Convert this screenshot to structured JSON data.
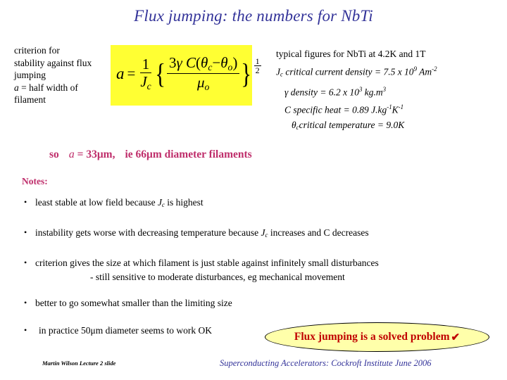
{
  "slide": {
    "title": "Flux jumping: the numbers for NbTi",
    "title_color": "#333399"
  },
  "left_block": {
    "line1": "criterion for",
    "line2": "stability against flux",
    "line3": "jumping",
    "line4_var": "a",
    "line4_rest": " = half width of",
    "line5": "filament"
  },
  "equation": {
    "box_color": "#ffff33",
    "lhs": "a",
    "equals": "=",
    "outer_num": "1",
    "outer_den_var": "J",
    "outer_den_sub": "c",
    "open_brace": "{",
    "close_brace": "}",
    "inner_num_a": "3",
    "inner_num_gamma": "γ",
    "inner_num_C": "C",
    "inner_num_open": "(",
    "inner_num_theta1": "θ",
    "inner_num_theta1_sub": "c",
    "inner_num_minus": "−",
    "inner_num_theta2": "θ",
    "inner_num_theta2_sub": "o",
    "inner_num_close": ")",
    "inner_den_mu": "μ",
    "inner_den_sub": "o",
    "exp_num": "1",
    "exp_den": "2",
    "plain_text": "a = (1/Jc){3γC(θc − θo)/μo}^(1/2)"
  },
  "right_block": {
    "heading": "typical figures for NbTi at 4.2K and 1T",
    "rows": [
      {
        "symbol": "J",
        "symbol_sub": "c",
        "label": " critical current density",
        "equals": " = ",
        "value": "7.5 x 10",
        "value_sup": "9",
        "unit": " Am",
        "unit_sup": "-2"
      },
      {
        "symbol": "γ",
        "symbol_sub": "",
        "label": " density",
        "equals": " = ",
        "value": "6.2 x 10",
        "value_sup": "3",
        "unit": " kg.m",
        "unit_sup": "3"
      },
      {
        "symbol": "C",
        "symbol_sub": "",
        "label": " specific heat",
        "equals": " = ",
        "value": "0.89",
        "value_sup": "",
        "unit": " J.kg",
        "unit_sup": "-1",
        "unit2": "K",
        "unit2_sup": "-1"
      },
      {
        "symbol": "θ",
        "symbol_sub": "c",
        "label": "critical temperature",
        "equals": "  = ",
        "value": "9.0K",
        "value_sup": "",
        "unit": "",
        "unit_sup": ""
      }
    ]
  },
  "result_line": {
    "so": "so",
    "var": "a",
    "equals": "=",
    "value": "33μm,",
    "note": "ie 66μm diameter filaments",
    "color": "#BF2E6B"
  },
  "notes": {
    "heading": "Notes:",
    "heading_color": "#BF2E6B",
    "items": [
      {
        "bullet": "•",
        "text_a": "least stable at low field because ",
        "sym": "J",
        "sym_sub": "c",
        "text_b": " is highest",
        "second_line": ""
      },
      {
        "bullet": "•",
        "text_a": "instability gets worse with decreasing temperature because ",
        "sym": "J",
        "sym_sub": "c",
        "text_b": " increases and C decreases",
        "second_line": ""
      },
      {
        "bullet": "•",
        "text_a": "criterion gives the size at which filament is just stable against infinitely small disturbances",
        "sym": "",
        "sym_sub": "",
        "text_b": "",
        "second_line": "- still sensitive to moderate disturbances, eg mechanical movement"
      },
      {
        "bullet": "•",
        "text_a": "better to go somewhat smaller than the limiting size",
        "sym": "",
        "sym_sub": "",
        "text_b": "",
        "second_line": ""
      },
      {
        "bullet": "•",
        "text_a": "in practice  50μm diameter seems to work OK",
        "sym": "",
        "sym_sub": "",
        "text_b": "",
        "second_line": ""
      }
    ]
  },
  "callout": {
    "text": "Flux jumping is a solved problem",
    "check": "✔",
    "fill": "#ffffaa",
    "text_color": "#C00000"
  },
  "footer": {
    "left": "Martin Wilson Lecture 2 slide",
    "right": "Superconducting Accelerators:  Cockroft Institute June 2006",
    "right_color": "#333399"
  }
}
